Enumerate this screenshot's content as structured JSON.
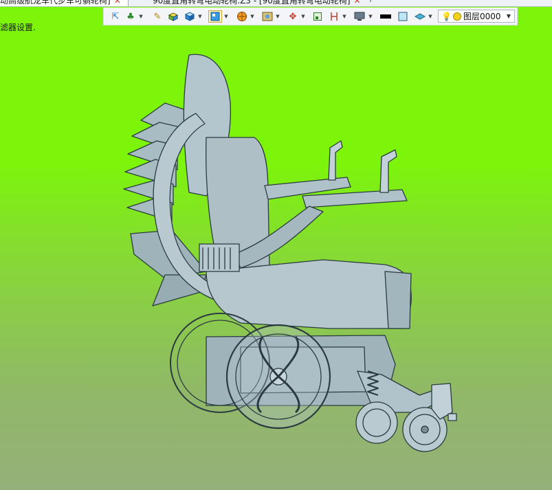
{
  "tabs": [
    {
      "label": "动高级航龙车代步车可躺轮椅]",
      "active": true
    },
    {
      "label": "90度直角转弯电动轮椅.Z3 - [90度直角转弯电动轮椅]",
      "active": false
    }
  ],
  "toolbar": {
    "icons": [
      "import-icon",
      "render-mode-icon",
      "pencil-icon",
      "shaded-box-icon",
      "view-cube-icon",
      "view-style-icon",
      "sphere-icon",
      "texture-icon",
      "axis-icon",
      "frame-icon",
      "bracket-icon",
      "monitor-icon",
      "color-swatch-icon",
      "box-color-icon",
      "layer-icon"
    ],
    "layer_selector": {
      "value": "图层0000"
    }
  },
  "status": {
    "filter_text": "滤器设置."
  },
  "colors": {
    "viewport_top": "#7cf50a",
    "viewport_bottom": "#95b07a",
    "model_fill": "#a8bcc4",
    "model_edge": "#2a3a40"
  }
}
